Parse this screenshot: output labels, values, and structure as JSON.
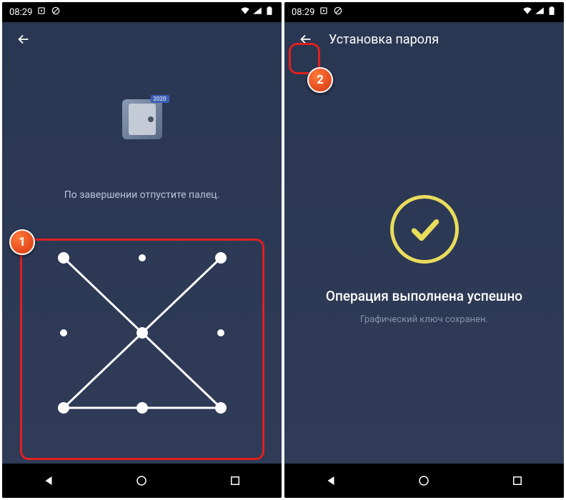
{
  "status": {
    "time": "08:29"
  },
  "screen1": {
    "instruction": "По завершении отпустите палец.",
    "vault_badge": "2020",
    "marker": "1"
  },
  "screen2": {
    "header_title": "Установка пароля",
    "success_title": "Операция выполнена успешно",
    "success_subtitle": "Графический ключ сохранен.",
    "marker": "2"
  },
  "accent_color": "#eadc5c"
}
